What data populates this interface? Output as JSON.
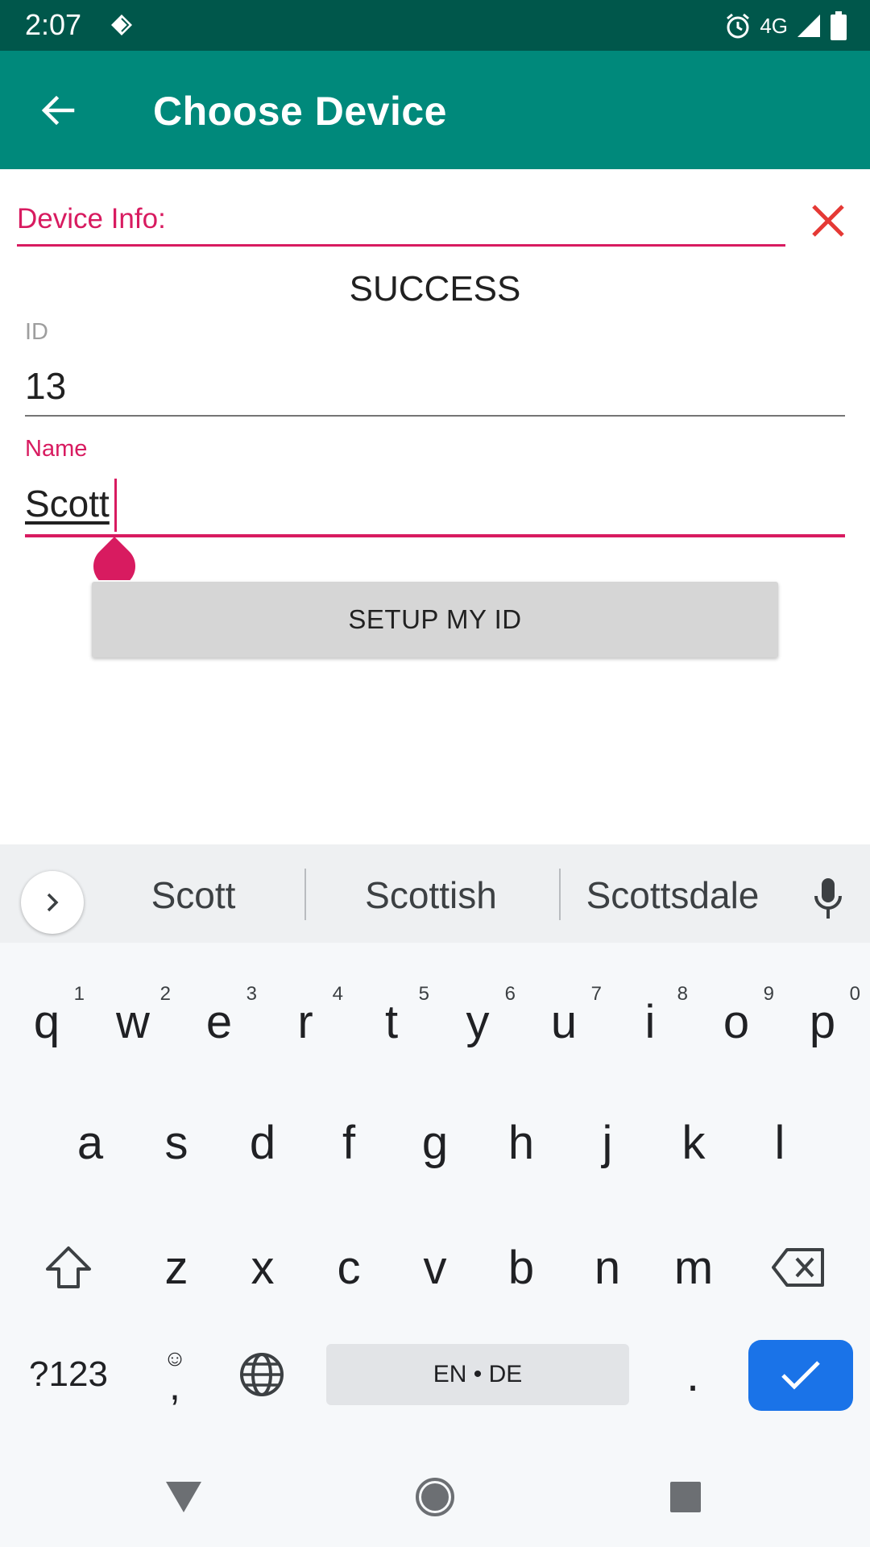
{
  "status_bar": {
    "time": "2:07",
    "network": "4G",
    "icons": [
      "diamond-icon",
      "alarm-icon",
      "signal-icon",
      "battery-icon"
    ]
  },
  "app_bar": {
    "title": "Choose Device",
    "back_icon": "arrow-back-icon"
  },
  "device_info": {
    "label": "Device Info:",
    "close_icon": "close-icon"
  },
  "status_message": "SUCCESS",
  "form": {
    "id_label": "ID",
    "id_value": "13",
    "name_label": "Name",
    "name_value": "Scott"
  },
  "setup_button": "SETUP MY ID",
  "keyboard": {
    "suggestions": [
      "Scott",
      "Scottish",
      "Scottsdale"
    ],
    "row1": [
      {
        "key": "q",
        "num": "1"
      },
      {
        "key": "w",
        "num": "2"
      },
      {
        "key": "e",
        "num": "3"
      },
      {
        "key": "r",
        "num": "4"
      },
      {
        "key": "t",
        "num": "5"
      },
      {
        "key": "y",
        "num": "6"
      },
      {
        "key": "u",
        "num": "7"
      },
      {
        "key": "i",
        "num": "8"
      },
      {
        "key": "o",
        "num": "9"
      },
      {
        "key": "p",
        "num": "0"
      }
    ],
    "row2": [
      "a",
      "s",
      "d",
      "f",
      "g",
      "h",
      "j",
      "k",
      "l"
    ],
    "row3": [
      "z",
      "x",
      "c",
      "v",
      "b",
      "n",
      "m"
    ],
    "symbols_key": "?123",
    "comma_key": ",",
    "space_label": "EN • DE",
    "period_key": "."
  },
  "colors": {
    "status_bar": "#00574b",
    "app_bar": "#00897b",
    "accent": "#d81b60",
    "close": "#e53935",
    "enter": "#1a73e8"
  }
}
